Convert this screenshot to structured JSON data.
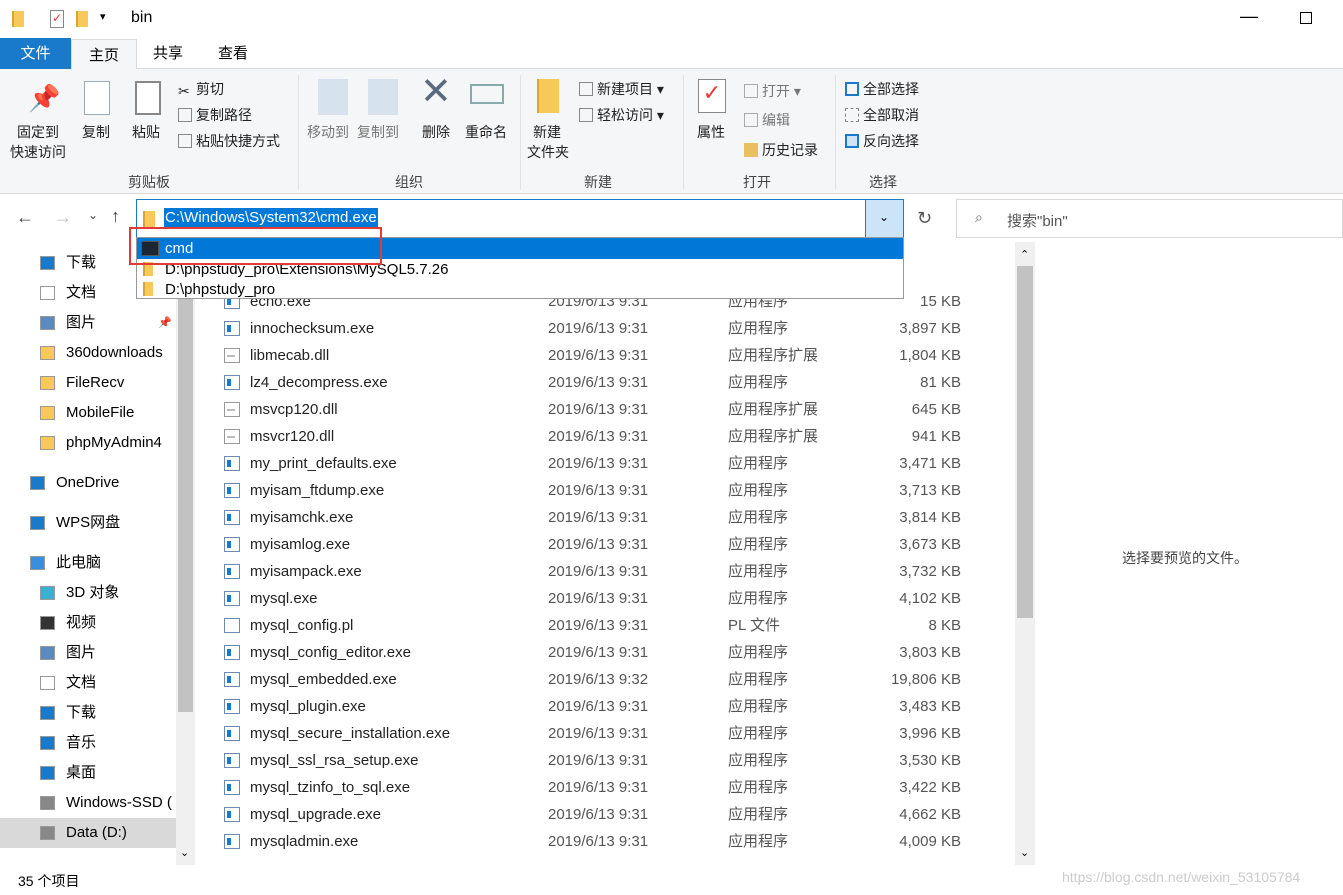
{
  "window": {
    "title": "bin"
  },
  "tabs": [
    {
      "label": "文件"
    },
    {
      "label": "主页"
    },
    {
      "label": "共享"
    },
    {
      "label": "查看"
    }
  ],
  "ribbon": {
    "clipboard": {
      "pin": "固定到",
      "pin2": "快速访问",
      "copy": "复制",
      "paste": "粘贴",
      "cut": "剪切",
      "copy_path": "复制路径",
      "paste_shortcut": "粘贴快捷方式",
      "group": "剪贴板"
    },
    "organize": {
      "move_to": "移动到",
      "copy_to": "复制到",
      "delete": "删除",
      "rename": "重命名",
      "group": "组织"
    },
    "new": {
      "new_folder": "新建",
      "new_folder2": "文件夹",
      "new_item": "新建项目",
      "easy_access": "轻松访问",
      "group": "新建"
    },
    "open": {
      "properties": "属性",
      "open": "打开",
      "edit": "编辑",
      "history": "历史记录",
      "group": "打开"
    },
    "select": {
      "select_all": "全部选择",
      "select_none": "全部取消",
      "invert": "反向选择",
      "group": "选择"
    }
  },
  "address": {
    "value": "C:\\Windows\\System32\\cmd.exe",
    "suggestions": [
      {
        "label": "cmd",
        "icon": "cmd-icon"
      },
      {
        "label": "D:\\phpstudy_pro\\Extensions\\MySQL5.7.26",
        "icon": "folder-icon"
      },
      {
        "label": "D:\\phpstudy_pro",
        "icon": "folder-icon"
      }
    ]
  },
  "search": {
    "placeholder": "搜索\"bin\""
  },
  "sidebar": [
    {
      "label": "下载",
      "icon": "download-icon"
    },
    {
      "label": "文档",
      "icon": "document-icon"
    },
    {
      "label": "图片",
      "icon": "picture-icon",
      "pinned": true
    },
    {
      "label": "360downloads",
      "icon": "folder-icon"
    },
    {
      "label": "FileRecv",
      "icon": "folder-icon"
    },
    {
      "label": "MobileFile",
      "icon": "folder-icon"
    },
    {
      "label": "phpMyAdmin4",
      "icon": "folder-icon"
    },
    {
      "label": "OneDrive",
      "icon": "cloud-icon"
    },
    {
      "label": "WPS网盘",
      "icon": "cloud-icon"
    },
    {
      "label": "此电脑",
      "icon": "computer-icon"
    },
    {
      "label": "3D 对象",
      "icon": "cube-icon"
    },
    {
      "label": "视频",
      "icon": "video-icon"
    },
    {
      "label": "图片",
      "icon": "picture-icon"
    },
    {
      "label": "文档",
      "icon": "document-icon"
    },
    {
      "label": "下载",
      "icon": "download-icon"
    },
    {
      "label": "音乐",
      "icon": "music-icon"
    },
    {
      "label": "桌面",
      "icon": "desktop-icon"
    },
    {
      "label": "Windows-SSD (",
      "icon": "drive-icon"
    },
    {
      "label": "Data (D:)",
      "icon": "drive-icon",
      "selected": true
    }
  ],
  "files": [
    {
      "name": "echo.exe",
      "date": "2019/6/13 9:31",
      "type": "应用程序",
      "size": "15 KB",
      "kind": "exe"
    },
    {
      "name": "innochecksum.exe",
      "date": "2019/6/13 9:31",
      "type": "应用程序",
      "size": "3,897 KB",
      "kind": "exe"
    },
    {
      "name": "libmecab.dll",
      "date": "2019/6/13 9:31",
      "type": "应用程序扩展",
      "size": "1,804 KB",
      "kind": "dll"
    },
    {
      "name": "lz4_decompress.exe",
      "date": "2019/6/13 9:31",
      "type": "应用程序",
      "size": "81 KB",
      "kind": "exe"
    },
    {
      "name": "msvcp120.dll",
      "date": "2019/6/13 9:31",
      "type": "应用程序扩展",
      "size": "645 KB",
      "kind": "dll"
    },
    {
      "name": "msvcr120.dll",
      "date": "2019/6/13 9:31",
      "type": "应用程序扩展",
      "size": "941 KB",
      "kind": "dll"
    },
    {
      "name": "my_print_defaults.exe",
      "date": "2019/6/13 9:31",
      "type": "应用程序",
      "size": "3,471 KB",
      "kind": "exe"
    },
    {
      "name": "myisam_ftdump.exe",
      "date": "2019/6/13 9:31",
      "type": "应用程序",
      "size": "3,713 KB",
      "kind": "exe"
    },
    {
      "name": "myisamchk.exe",
      "date": "2019/6/13 9:31",
      "type": "应用程序",
      "size": "3,814 KB",
      "kind": "exe"
    },
    {
      "name": "myisamlog.exe",
      "date": "2019/6/13 9:31",
      "type": "应用程序",
      "size": "3,673 KB",
      "kind": "exe"
    },
    {
      "name": "myisampack.exe",
      "date": "2019/6/13 9:31",
      "type": "应用程序",
      "size": "3,732 KB",
      "kind": "exe"
    },
    {
      "name": "mysql.exe",
      "date": "2019/6/13 9:31",
      "type": "应用程序",
      "size": "4,102 KB",
      "kind": "exe"
    },
    {
      "name": "mysql_config.pl",
      "date": "2019/6/13 9:31",
      "type": "PL 文件",
      "size": "8 KB",
      "kind": "pl"
    },
    {
      "name": "mysql_config_editor.exe",
      "date": "2019/6/13 9:31",
      "type": "应用程序",
      "size": "3,803 KB",
      "kind": "exe"
    },
    {
      "name": "mysql_embedded.exe",
      "date": "2019/6/13 9:32",
      "type": "应用程序",
      "size": "19,806 KB",
      "kind": "exe"
    },
    {
      "name": "mysql_plugin.exe",
      "date": "2019/6/13 9:31",
      "type": "应用程序",
      "size": "3,483 KB",
      "kind": "exe"
    },
    {
      "name": "mysql_secure_installation.exe",
      "date": "2019/6/13 9:31",
      "type": "应用程序",
      "size": "3,996 KB",
      "kind": "exe"
    },
    {
      "name": "mysql_ssl_rsa_setup.exe",
      "date": "2019/6/13 9:31",
      "type": "应用程序",
      "size": "3,530 KB",
      "kind": "exe"
    },
    {
      "name": "mysql_tzinfo_to_sql.exe",
      "date": "2019/6/13 9:31",
      "type": "应用程序",
      "size": "3,422 KB",
      "kind": "exe"
    },
    {
      "name": "mysql_upgrade.exe",
      "date": "2019/6/13 9:31",
      "type": "应用程序",
      "size": "4,662 KB",
      "kind": "exe"
    },
    {
      "name": "mysqladmin.exe",
      "date": "2019/6/13 9:31",
      "type": "应用程序",
      "size": "4,009 KB",
      "kind": "exe"
    }
  ],
  "preview": {
    "message": "选择要预览的文件。"
  },
  "status": {
    "count": "35 个项目"
  },
  "watermark": "https://blog.csdn.net/weixin_53105784",
  "colors": {
    "accent": "#0078d7",
    "file_tab": "#1979ca",
    "highlight_box": "#e53935"
  }
}
